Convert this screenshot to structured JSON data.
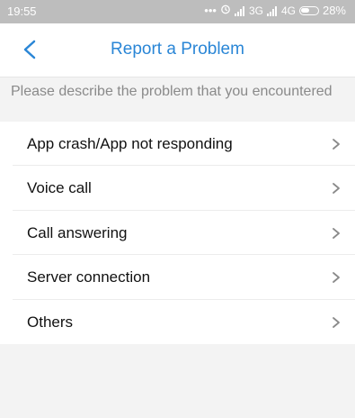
{
  "status_bar": {
    "time": "19:55",
    "dots": "•••",
    "alarm_icon": "alarm-icon",
    "network_1": "3G",
    "network_2": "4G",
    "battery_percent": "28%"
  },
  "header": {
    "title": "Report a Problem",
    "back_icon": "back-chevron-icon"
  },
  "section": {
    "label": "Please describe the problem that you encountered"
  },
  "items": [
    {
      "label": "App crash/App not responding"
    },
    {
      "label": "Voice call"
    },
    {
      "label": "Call answering"
    },
    {
      "label": "Server connection"
    },
    {
      "label": "Others"
    }
  ],
  "colors": {
    "accent": "#2a86d6",
    "status_bar_bg": "#bdbdbd",
    "page_bg": "#f3f3f3"
  }
}
